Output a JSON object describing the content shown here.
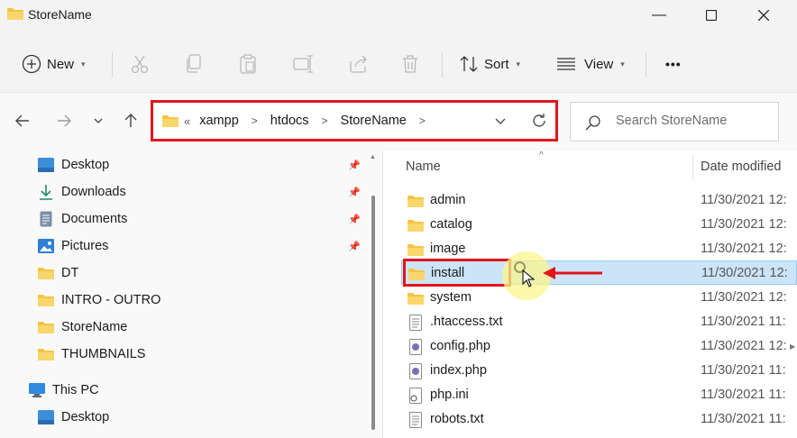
{
  "window": {
    "title": "StoreName",
    "controls": [
      "minimize",
      "maximize",
      "close"
    ]
  },
  "toolbar": {
    "new_label": "New",
    "sort_label": "Sort",
    "view_label": "View",
    "more_label": "•••",
    "icons": [
      "cut-icon",
      "copy-icon",
      "paste-icon",
      "rename-icon",
      "share-icon",
      "delete-icon"
    ]
  },
  "address": {
    "overflow": "«",
    "crumbs": [
      "xampp",
      "htdocs",
      "StoreName"
    ]
  },
  "search": {
    "placeholder": "Search StoreName"
  },
  "sidebar": {
    "items": [
      {
        "label": "Desktop",
        "icon": "desktop-icon",
        "pinned": true
      },
      {
        "label": "Downloads",
        "icon": "download-icon",
        "pinned": true
      },
      {
        "label": "Documents",
        "icon": "document-icon",
        "pinned": true
      },
      {
        "label": "Pictures",
        "icon": "pictures-icon",
        "pinned": true
      },
      {
        "label": "DT",
        "icon": "folder-icon",
        "pinned": false
      },
      {
        "label": "INTRO - OUTRO",
        "icon": "folder-icon",
        "pinned": false
      },
      {
        "label": "StoreName",
        "icon": "folder-icon",
        "pinned": false
      },
      {
        "label": "THUMBNAILS",
        "icon": "folder-icon",
        "pinned": false
      }
    ],
    "this_pc": "This PC",
    "this_pc_items": [
      {
        "label": "Desktop",
        "icon": "desktop-icon"
      }
    ]
  },
  "content": {
    "columns": {
      "name": "Name",
      "date": "Date modified"
    },
    "files": [
      {
        "name": "admin",
        "type": "folder",
        "date": "11/30/2021 12:"
      },
      {
        "name": "catalog",
        "type": "folder",
        "date": "11/30/2021 12:"
      },
      {
        "name": "image",
        "type": "folder",
        "date": "11/30/2021 12:"
      },
      {
        "name": "install",
        "type": "folder",
        "date": "11/30/2021 12:",
        "selected": true
      },
      {
        "name": "system",
        "type": "folder",
        "date": "11/30/2021 12:"
      },
      {
        "name": ".htaccess.txt",
        "type": "text",
        "date": "11/30/2021 11:"
      },
      {
        "name": "config.php",
        "type": "php",
        "date": "11/30/2021 12:"
      },
      {
        "name": "index.php",
        "type": "php",
        "date": "11/30/2021 11:"
      },
      {
        "name": "php.ini",
        "type": "ini",
        "date": "11/30/2021 11:"
      },
      {
        "name": "robots.txt",
        "type": "text",
        "date": "11/30/2021 11:"
      }
    ]
  },
  "colors": {
    "highlight_red": "#e0161d",
    "selection_bg": "#cce4f7",
    "folder_yellow": "#f4c542"
  }
}
